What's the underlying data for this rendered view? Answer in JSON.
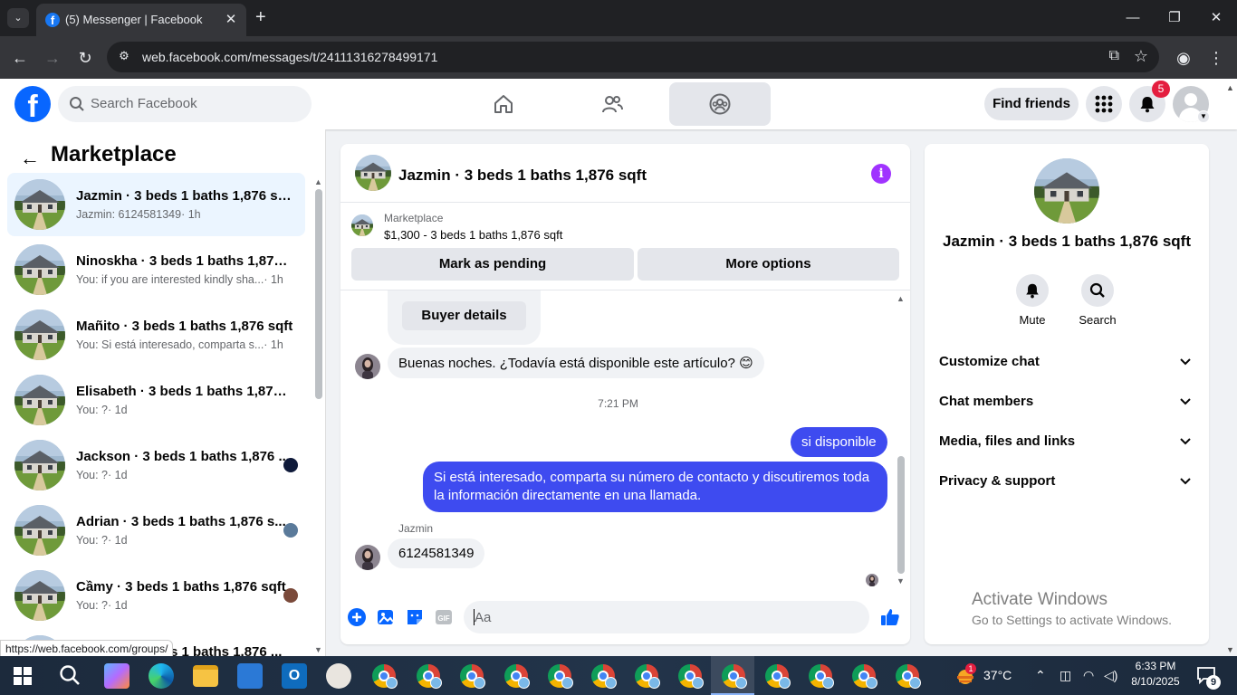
{
  "browser": {
    "tab_title": "(5) Messenger | Facebook",
    "url": "web.facebook.com/messages/t/24111316278499171",
    "status_url": "https://web.facebook.com/groups/"
  },
  "header": {
    "search_placeholder": "Search Facebook",
    "find_friends": "Find friends",
    "notification_count": "5"
  },
  "sidebar": {
    "title": "Marketplace",
    "conversations": [
      {
        "name": "Jazmin · 3 beds 1 baths 1,876 sqft",
        "preview": "Jazmin: 6124581349",
        "time": "· 1h",
        "active": true
      },
      {
        "name": "Ninoskha · 3 beds 1 baths 1,876 ...",
        "preview": "You: if you are interested kindly sha...",
        "time": "· 1h"
      },
      {
        "name": "Mañito · 3 beds 1 baths 1,876 sqft",
        "preview": "You: Si está interesado, comparta s...",
        "time": "· 1h"
      },
      {
        "name": "Elisabeth · 3 beds 1 baths 1,876 s...",
        "preview": "You: ?",
        "time": "· 1d"
      },
      {
        "name": "Jackson · 3 beds 1 baths 1,876 ...",
        "preview": "You: ?",
        "time": "· 1d"
      },
      {
        "name": "Adrian · 3 beds 1 baths 1,876 s...",
        "preview": "You: ?",
        "time": "· 1d"
      },
      {
        "name": "Cầmy · 3 beds 1 baths 1,876 sqft",
        "preview": "You: ?",
        "time": "· 1d"
      },
      {
        "name": "s 1 baths 1,876 ...",
        "preview": "",
        "time": ""
      }
    ]
  },
  "chat": {
    "title": "Jazmin · 3 beds 1 baths 1,876 sqft",
    "listing_label": "Marketplace",
    "listing_price": "$1,300 - 3 beds 1 baths 1,876 sqft",
    "mark_pending": "Mark as pending",
    "more_options": "More options",
    "buyer_details": "Buyer details",
    "msg1": "Buenas noches. ¿Todavía está disponible este artículo? 😊",
    "timestamp": "7:21 PM",
    "msg2": "si disponible",
    "msg3": "Si está interesado, comparta su número de contacto y discutiremos toda la información directamente en una llamada.",
    "sender": "Jazmin",
    "msg4": "6124581349",
    "input_placeholder": "Aa"
  },
  "info_panel": {
    "name": "Jazmin · 3 beds 1 baths 1,876 sqft",
    "mute": "Mute",
    "search": "Search",
    "sections": [
      "Customize chat",
      "Chat members",
      "Media, files and links",
      "Privacy & support"
    ]
  },
  "watermark": {
    "line1": "Activate Windows",
    "line2": "Go to Settings to activate Windows."
  },
  "taskbar": {
    "temperature": "37°C",
    "weather_badge": "1",
    "time": "6:33 PM",
    "date": "8/10/2025",
    "notif_count": "9"
  },
  "colors": {
    "facebook_blue": "#0866ff",
    "outgoing_bubble": "#3e4bf0",
    "info_purple": "#a033ff",
    "badge_red": "#e41e3f"
  }
}
